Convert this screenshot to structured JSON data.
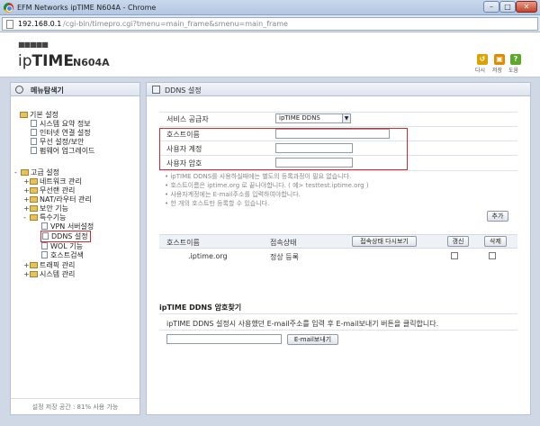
{
  "window": {
    "title": "EFM Networks ipTIME N604A - Chrome",
    "min": "–",
    "max": "□",
    "close": "✕"
  },
  "address": {
    "host": "192.168.0.1",
    "path": "/cgi-bin/timepro.cgi?tmenu=main_frame&smenu=main_frame"
  },
  "header": {
    "grid_logo": "■■■■■",
    "brand_prefix": "ip",
    "brand_bold": "TIME",
    "model": "N604A",
    "tools": [
      {
        "icon": "refresh-icon",
        "glyph": "↺",
        "label": "다시"
      },
      {
        "icon": "save-icon",
        "glyph": "▣",
        "label": "저장"
      },
      {
        "icon": "help-icon",
        "glyph": "?",
        "label": "도움"
      }
    ]
  },
  "sidebar": {
    "title": "메뉴탐색기",
    "basic": {
      "label": "기본 설정",
      "items": [
        "시스템 요약 정보",
        "인터넷 연결 설정",
        "무선 설정/보안",
        "펌웨어 업그레이드"
      ]
    },
    "advanced": {
      "label": "고급 설정",
      "items": [
        "네트워크 관리",
        "무선랜 관리",
        "NAT/라우터 관리",
        "보안 기능",
        "특수기능"
      ]
    },
    "special_items": [
      "VPN 서버설정",
      "DDNS 설정",
      "WOL 기능",
      "호스트검색"
    ],
    "after_items": [
      "트래픽 관리",
      "시스템 관리"
    ],
    "footer": "설정 저장 공간 : 81% 사용 가능"
  },
  "main": {
    "title": "DDNS 설정",
    "form": {
      "provider_label": "서비스 공급자",
      "provider_value": "ipTIME DDNS",
      "hostname_label": "호스트이름",
      "hostname_value": "",
      "user_label": "사용자 계정",
      "user_value": "",
      "password_label": "사용자 암호",
      "password_value": ""
    },
    "notes": [
      "ipTIME DDNS를 사용하실때에는 별도의 등록과정이 필요 없습니다.",
      "호스트이름은 iptime.org 로 끝나야합니다. ( 예> testtest.iptime.org )",
      "사용자계정에는 E-mail주소를 입력하여야합니다.",
      "한 개의 호스트만 등록할 수 있습니다."
    ],
    "add_button": "추가",
    "table": {
      "col_host": "호스트이름",
      "col_status": "접속상태",
      "refresh_status_button": "접속상태 다시보기",
      "renew_button": "갱신",
      "delete_button": "삭제",
      "rows": [
        {
          "host": ".iptime.org",
          "status": "정상 등록"
        }
      ]
    },
    "find_password": {
      "title": "ipTIME DDNS 암호찾기",
      "description": "ipTIME DDNS 설정시 사용했던 E-mail주소를 입력 후 E-mail보내기 버튼을 클릭합니다.",
      "email_value": "",
      "send_button": "E-mail보내기"
    }
  }
}
